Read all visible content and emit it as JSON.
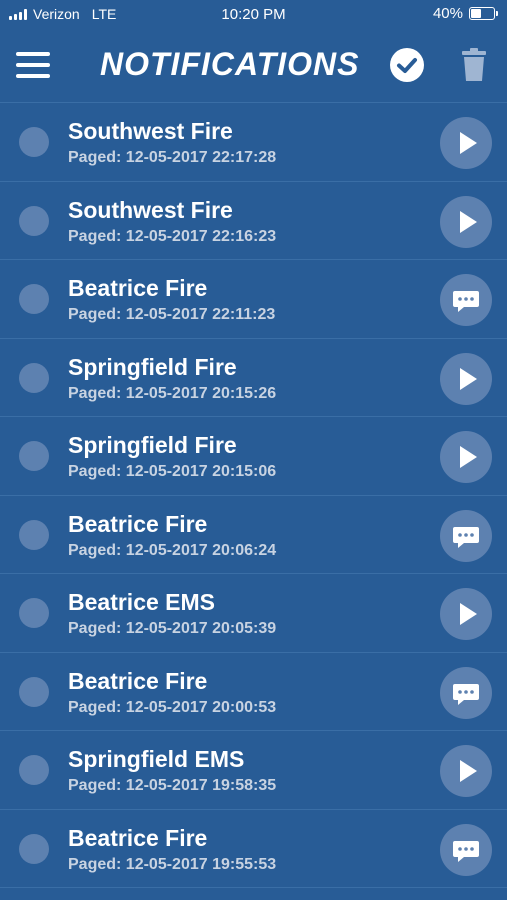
{
  "status": {
    "carrier": "Verizon",
    "network": "LTE",
    "time": "10:20 PM",
    "battery": "40%",
    "battery_level": 0.4
  },
  "header": {
    "title": "NOTIFICATIONS",
    "icons": [
      "menu-icon",
      "check-circle-icon",
      "trash-icon"
    ]
  },
  "notifications": [
    {
      "title": "Southwest Fire",
      "paged": "Paged: 12-05-2017 22:17:28",
      "icon": "play-icon"
    },
    {
      "title": "Southwest Fire",
      "paged": "Paged: 12-05-2017 22:16:23",
      "icon": "play-icon"
    },
    {
      "title": "Beatrice Fire",
      "paged": "Paged: 12-05-2017 22:11:23",
      "icon": "message-icon"
    },
    {
      "title": "Springfield Fire",
      "paged": "Paged: 12-05-2017 20:15:26",
      "icon": "play-icon"
    },
    {
      "title": "Springfield Fire",
      "paged": "Paged: 12-05-2017 20:15:06",
      "icon": "play-icon"
    },
    {
      "title": "Beatrice Fire",
      "paged": "Paged: 12-05-2017 20:06:24",
      "icon": "message-icon"
    },
    {
      "title": "Beatrice EMS",
      "paged": "Paged: 12-05-2017 20:05:39",
      "icon": "play-icon"
    },
    {
      "title": "Beatrice Fire",
      "paged": "Paged: 12-05-2017 20:00:53",
      "icon": "message-icon"
    },
    {
      "title": "Springfield EMS",
      "paged": "Paged: 12-05-2017 19:58:35",
      "icon": "play-icon"
    },
    {
      "title": "Beatrice Fire",
      "paged": "Paged: 12-05-2017 19:55:53",
      "icon": "message-icon"
    }
  ]
}
